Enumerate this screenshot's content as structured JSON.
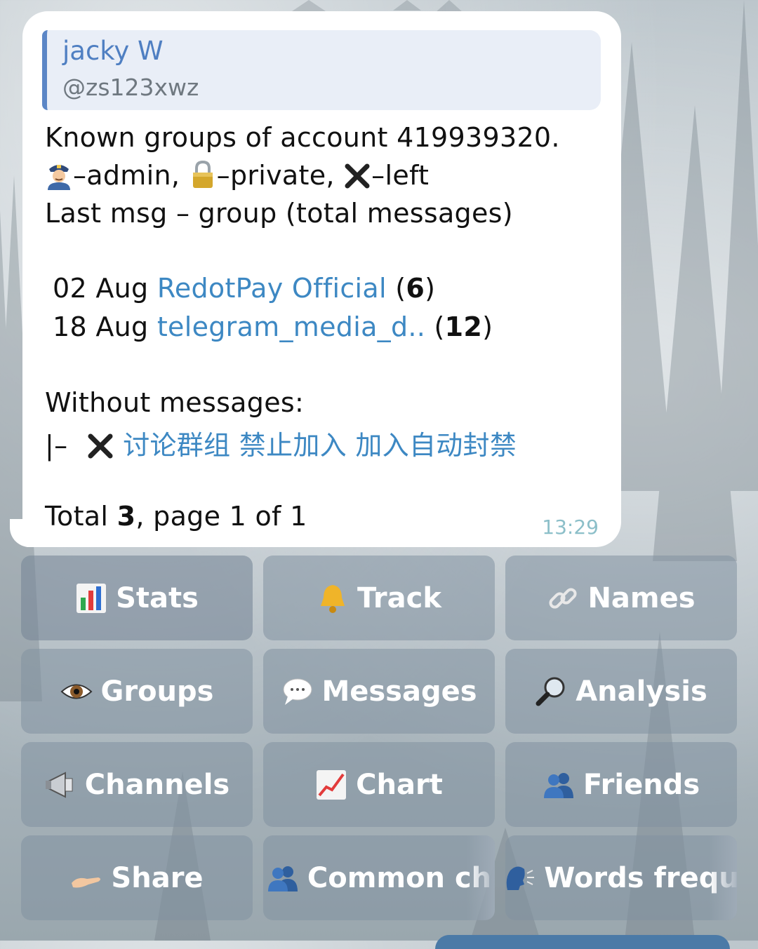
{
  "message": {
    "reply": {
      "name": "jacky W",
      "handle": "@zs123xwz"
    },
    "line1": "Known groups of account 419939320.",
    "legend": {
      "admin": "–admin,",
      "private": "–private,",
      "left": "–left"
    },
    "line3": "Last msg – group (total messages)",
    "groups": [
      {
        "date": "02 Aug",
        "name": "RedotPay Official",
        "open": "(",
        "count": "6",
        "close": ")"
      },
      {
        "date": "18 Aug",
        "name": "telegram_media_d..",
        "open": "(",
        "count": "12",
        "close": ")"
      }
    ],
    "without_label": "Without messages:",
    "without_prefix": "|–",
    "without_group": "讨论群组 禁止加入 加入自动封禁",
    "total_prefix": "Total ",
    "total_count": "3",
    "total_suffix": ", page 1 of 1",
    "time": "13:29"
  },
  "keyboard": [
    {
      "label": "Stats",
      "icon": "bar-chart-icon"
    },
    {
      "label": "Track",
      "icon": "bell-icon"
    },
    {
      "label": "Names",
      "icon": "link-icon"
    },
    {
      "label": "Groups",
      "icon": "eye-icon"
    },
    {
      "label": "Messages",
      "icon": "speech-bubble-icon"
    },
    {
      "label": "Analysis",
      "icon": "magnifier-icon"
    },
    {
      "label": "Channels",
      "icon": "megaphone-icon"
    },
    {
      "label": "Chart",
      "icon": "chart-increasing-icon"
    },
    {
      "label": "Friends",
      "icon": "people-icon"
    },
    {
      "label": "Share",
      "icon": "open-hand-icon"
    },
    {
      "label": "Common ch",
      "icon": "people-icon"
    },
    {
      "label": "Words frequ",
      "icon": "speaking-head-icon"
    }
  ],
  "colors": {
    "link": "#3d88c3",
    "reply_bar": "#5b86c6",
    "time": "#8cbfc9"
  }
}
